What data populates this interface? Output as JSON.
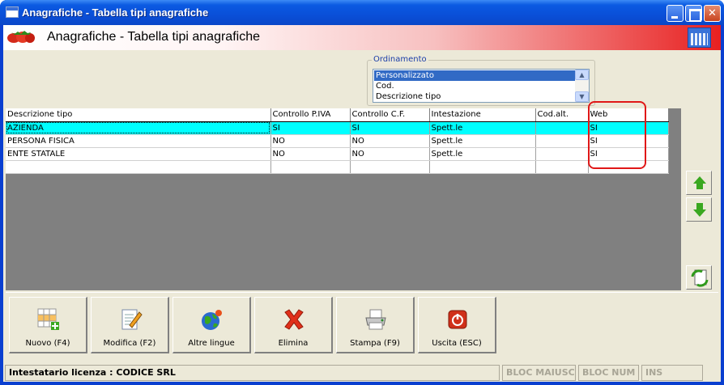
{
  "window": {
    "title": "Anagrafiche - Tabella tipi anagrafiche"
  },
  "header": {
    "title": "Anagrafiche - Tabella tipi anagrafiche"
  },
  "ordering": {
    "legend": "Ordinamento",
    "options": [
      "Personalizzato",
      "Cod.",
      "Descrizione tipo"
    ],
    "selected": "Personalizzato"
  },
  "grid": {
    "columns": [
      "Descrizione tipo",
      "Controllo P.IVA",
      "Controllo C.F.",
      "Intestazione",
      "Cod.alt.",
      "Web"
    ],
    "rows": [
      [
        "AZIENDA",
        "SI",
        "SI",
        "Spett.le",
        "",
        "SI"
      ],
      [
        "PERSONA FISICA",
        "NO",
        "NO",
        "Spett.le",
        "",
        "SI"
      ],
      [
        "ENTE STATALE",
        "NO",
        "NO",
        "Spett.le",
        "",
        "SI"
      ],
      [
        "",
        "",
        "",
        "",
        "",
        ""
      ]
    ],
    "active_row": 0
  },
  "toolbar": {
    "new_label": "Nuovo (F4)",
    "edit_label": "Modifica (F2)",
    "languages_label": "Altre lingue",
    "delete_label": "Elimina",
    "print_label": "Stampa (F9)",
    "exit_label": "Uscita (ESC)"
  },
  "status": {
    "license": "Intestatario licenza : CODICE SRL",
    "caps": "BLOC MAIUSC",
    "num": "BLOC NUM",
    "ins": "INS"
  },
  "colors": {
    "titlebar": "#0a4fd8",
    "selection": "#316ac5",
    "active_row": "#00ffff",
    "highlight": "#e01818"
  }
}
